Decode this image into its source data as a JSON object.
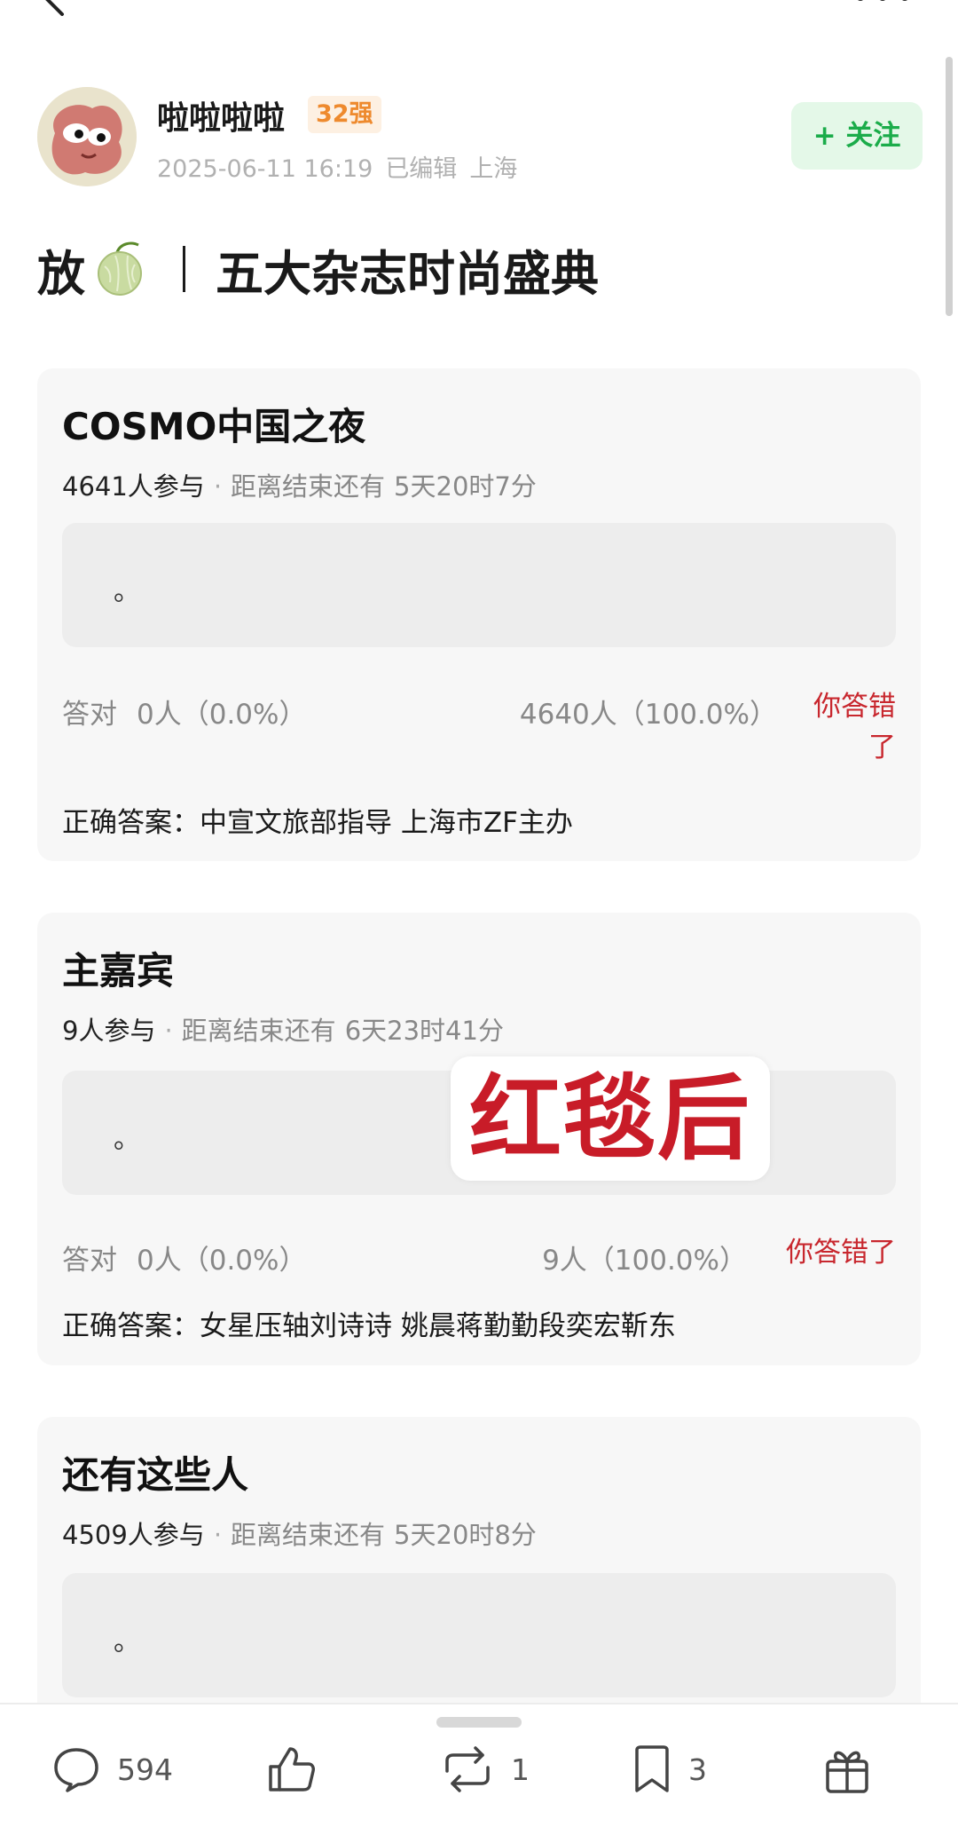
{
  "header": {
    "back_icon": "back-arrow-icon",
    "more_icon": "more-dots-icon"
  },
  "author": {
    "name": "啦啦啦啦",
    "badge": "32强",
    "date": "2025-06-11 16:19",
    "edited": "已编辑",
    "location": "上海",
    "follow_label": "+ 关注"
  },
  "post": {
    "title_prefix": "放",
    "title_icon": "melon-icon",
    "title_main": "五大杂志时尚盛典"
  },
  "cards": [
    {
      "title": "COSMO中国之夜",
      "participants": "4641人参与",
      "deadline_label": "距离结束还有",
      "deadline_time": "5天20时7分",
      "option_text": "。",
      "correct_label": "答对",
      "correct_value": "0人（0.0%）",
      "wrong_value": "4640人（100.0%）",
      "wrong_tag": "你答错了",
      "answer_label": "正确答案：",
      "answer": "中宣文旅部指导 上海市ZF主办"
    },
    {
      "title": "主嘉宾",
      "participants": "9人参与",
      "deadline_label": "距离结束还有",
      "deadline_time": "6天23时41分",
      "option_text": "。",
      "correct_label": "答对",
      "correct_value": "0人（0.0%）",
      "wrong_value": "9人（100.0%）",
      "wrong_tag": "你答错了",
      "answer_label": "正确答案：",
      "answer": "女星压轴刘诗诗 姚晨蒋勤勤段奕宏靳东"
    },
    {
      "title": "还有这些人",
      "participants": "4509人参与",
      "deadline_label": "距离结束还有",
      "deadline_time": "5天20时8分",
      "option_text": "。"
    }
  ],
  "overlay": {
    "text": "红毯后"
  },
  "bottom_bar": {
    "comments": "594",
    "likes_icon": "thumbs-up-icon",
    "reposts": "1",
    "bookmarks": "3",
    "gift_icon": "gift-icon"
  },
  "colors": {
    "accent_green": "#1bac4a",
    "wrong_red": "#c8272e",
    "badge_orange": "#ee8a2e",
    "overlay_red": "#c81c28"
  }
}
